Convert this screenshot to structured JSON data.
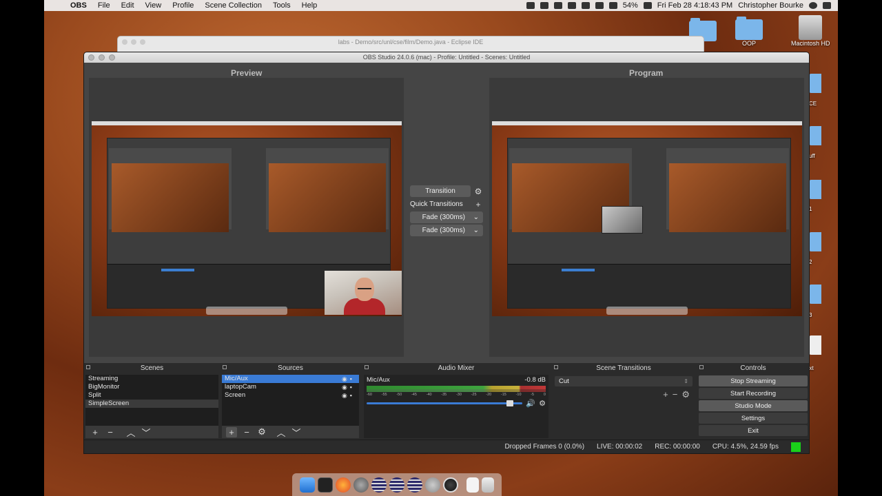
{
  "menubar": {
    "app": "OBS",
    "items": [
      "File",
      "Edit",
      "View",
      "Profile",
      "Scene Collection",
      "Tools",
      "Help"
    ],
    "battery": "54%",
    "clock": "Fri Feb 28  4:18:43 PM",
    "user": "Christopher Bourke"
  },
  "desktop": {
    "icons": [
      {
        "label": ""
      },
      {
        "label": "OOP"
      },
      {
        "label": "Macintosh HD"
      }
    ],
    "edge_labels": [
      "CE",
      "uff",
      "1",
      "2",
      "3",
      ".txt"
    ]
  },
  "eclipse": {
    "title": "labs - Demo/src/unl/cse/film/Demo.java - Eclipse IDE"
  },
  "obs": {
    "title": "OBS Studio 24.0.6 (mac) - Profile: Untitled - Scenes: Untitled",
    "preview_label": "Preview",
    "program_label": "Program",
    "transition_button": "Transition",
    "quick_transitions": "Quick Transitions",
    "fade_1": "Fade (300ms)",
    "fade_2": "Fade (300ms)",
    "scenes": {
      "title": "Scenes",
      "items": [
        "Streaming",
        "BigMonitor",
        "Split",
        "SimpleScreen"
      ]
    },
    "sources": {
      "title": "Sources",
      "items": [
        "Mic/Aux",
        "laptopCam",
        "Screen"
      ]
    },
    "mixer": {
      "title": "Audio Mixer",
      "channel": "Mic/Aux",
      "db": "-0.8 dB",
      "ticks": [
        "-60",
        "-55",
        "-50",
        "-45",
        "-40",
        "-35",
        "-30",
        "-25",
        "-20",
        "-15",
        "-10",
        "-5",
        "0"
      ],
      "volume_fraction": 0.94
    },
    "scene_transitions": {
      "title": "Scene Transitions",
      "selected": "Cut"
    },
    "controls": {
      "title": "Controls",
      "stop_streaming": "Stop Streaming",
      "start_recording": "Start Recording",
      "studio_mode": "Studio Mode",
      "settings": "Settings",
      "exit": "Exit"
    },
    "status": {
      "dropped": "Dropped Frames 0 (0.0%)",
      "live": "LIVE: 00:00:02",
      "rec": "REC: 00:00:00",
      "cpu": "CPU: 4.5%, 24.59 fps",
      "indicator_color": "#1ad11a"
    }
  },
  "colors": {
    "accent": "#3a7bd5",
    "panel": "#2b2b2b"
  },
  "dock_apps": [
    "finder-icon",
    "terminal-icon",
    "firefox-icon",
    "system-prefs-icon",
    "eclipse-icon",
    "eclipse-icon",
    "eclipse-icon",
    "texshop-icon",
    "obs-icon",
    "document-icon",
    "trash-icon"
  ]
}
